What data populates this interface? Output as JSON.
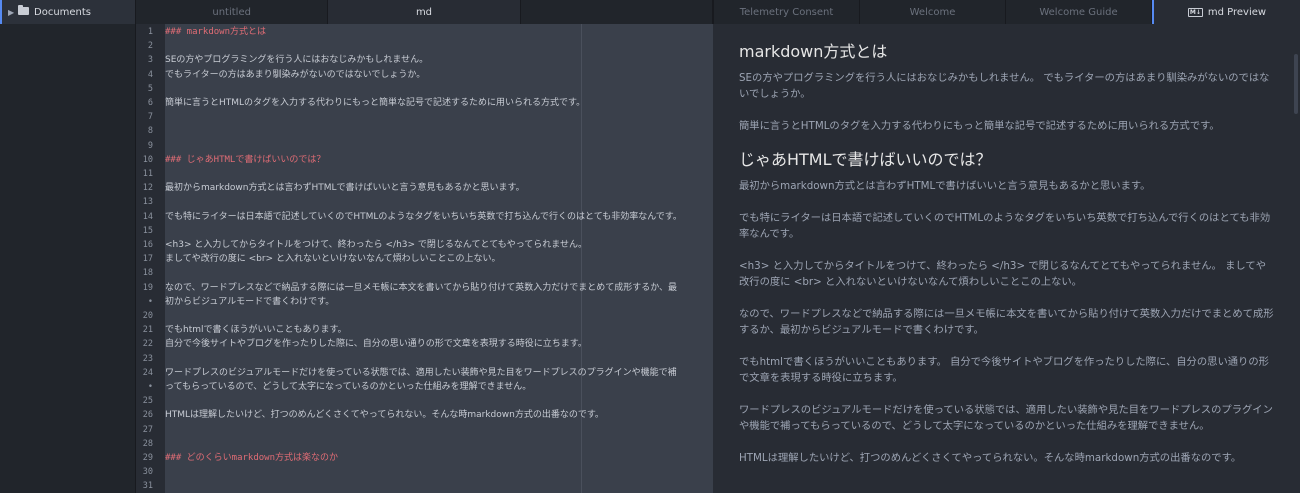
{
  "tree": {
    "root_label": "Documents"
  },
  "left_tabs": [
    {
      "label": "untitled",
      "active": false
    },
    {
      "label": "md",
      "active": true
    },
    {
      "label": "",
      "active": false
    }
  ],
  "right_tabs": [
    {
      "label": "Telemetry Consent"
    },
    {
      "label": "Welcome"
    },
    {
      "label": "Welcome Guide"
    },
    {
      "label": "md Preview"
    }
  ],
  "editor": {
    "lines": [
      {
        "n": "1",
        "text": "### markdown方式とは",
        "kind": "heading"
      },
      {
        "n": "2",
        "text": "",
        "kind": "text"
      },
      {
        "n": "3",
        "text": "SEの方やプログラミングを行う人にはおなじみかもしれません。",
        "kind": "text"
      },
      {
        "n": "4",
        "text": "でもライターの方はあまり馴染みがないのではないでしょうか。",
        "kind": "text"
      },
      {
        "n": "5",
        "text": "",
        "kind": "text"
      },
      {
        "n": "6",
        "text": "簡単に言うとHTMLのタグを入力する代わりにもっと簡単な記号で記述するために用いられる方式です。",
        "kind": "text"
      },
      {
        "n": "7",
        "text": "",
        "kind": "text"
      },
      {
        "n": "8",
        "text": "",
        "kind": "text"
      },
      {
        "n": "9",
        "text": "",
        "kind": "text"
      },
      {
        "n": "10",
        "text": "### じゃあHTMLで書けばいいのでは？",
        "kind": "heading"
      },
      {
        "n": "11",
        "text": "",
        "kind": "text"
      },
      {
        "n": "12",
        "text": "最初からmarkdown方式とは言わずHTMLで書けばいいと言う意見もあるかと思います。",
        "kind": "text"
      },
      {
        "n": "13",
        "text": "",
        "kind": "text"
      },
      {
        "n": "14",
        "text": "でも特にライターは日本語で記述していくのでHTMLのようなタグをいちいち英数で打ち込んで行くのはとても非効率なんです。",
        "kind": "text"
      },
      {
        "n": "15",
        "text": "",
        "kind": "text"
      },
      {
        "n": "16",
        "text": "<h3> と入力してからタイトルをつけて、終わったら </h3> で閉じるなんてとてもやってられません。",
        "kind": "text"
      },
      {
        "n": "17",
        "text": "ましてや改行の度に <br> と入れないといけないなんて煩わしいことこの上ない。",
        "kind": "text"
      },
      {
        "n": "18",
        "text": "",
        "kind": "text"
      },
      {
        "n": "19",
        "text": "なので、ワードプレスなどで納品する際には一旦メモ帳に本文を書いてから貼り付けて英数入力だけでまとめて成形するか、最",
        "kind": "text"
      },
      {
        "n": "•",
        "text": "初からビジュアルモードで書くわけです。",
        "kind": "text"
      },
      {
        "n": "20",
        "text": "",
        "kind": "text"
      },
      {
        "n": "21",
        "text": "でもhtmlで書くほうがいいこともあります。",
        "kind": "text"
      },
      {
        "n": "22",
        "text": "自分で今後サイトやブログを作ったりした際に、自分の思い通りの形で文章を表現する時役に立ちます。",
        "kind": "text"
      },
      {
        "n": "23",
        "text": "",
        "kind": "text"
      },
      {
        "n": "24",
        "text": "ワードプレスのビジュアルモードだけを使っている状態では、適用したい装飾や見た目をワードプレスのプラグインや機能で補",
        "kind": "text"
      },
      {
        "n": "•",
        "text": "ってもらっているので、どうして太字になっているのかといった仕組みを理解できません。",
        "kind": "text"
      },
      {
        "n": "25",
        "text": "",
        "kind": "text"
      },
      {
        "n": "26",
        "text": "HTMLは理解したいけど、打つのめんどくさくてやってられない。そんな時markdown方式の出番なのです。",
        "kind": "text"
      },
      {
        "n": "27",
        "text": "",
        "kind": "text"
      },
      {
        "n": "28",
        "text": "",
        "kind": "text"
      },
      {
        "n": "29",
        "text": "### どのくらいmarkdown方式は楽なのか",
        "kind": "heading"
      },
      {
        "n": "30",
        "text": "",
        "kind": "text"
      },
      {
        "n": "31",
        "text": "",
        "kind": "text"
      }
    ]
  },
  "preview": {
    "h1": "markdown方式とは",
    "p1": "SEの方やプログラミングを行う人にはおなじみかもしれません。 でもライターの方はあまり馴染みがないのではないでしょうか。",
    "p2": "簡単に言うとHTMLのタグを入力する代わりにもっと簡単な記号で記述するために用いられる方式です。",
    "h2": "じゃあHTMLで書けばいいのでは？",
    "p3": "最初からmarkdown方式とは言わずHTMLで書けばいいと言う意見もあるかと思います。",
    "p4": "でも特にライターは日本語で記述していくのでHTMLのようなタグをいちいち英数で打ち込んで行くのはとても非効率なんです。",
    "p5": "<h3> と入力してからタイトルをつけて、終わったら </h3> で閉じるなんてとてもやってられません。 ましてや改行の度に <br> と入れないといけないなんて煩わしいことこの上ない。",
    "p6": "なので、ワードプレスなどで納品する際には一旦メモ帳に本文を書いてから貼り付けて英数入力だけでまとめて成形するか、最初からビジュアルモードで書くわけです。",
    "p7": "でもhtmlで書くほうがいいこともあります。 自分で今後サイトやブログを作ったりした際に、自分の思い通りの形で文章を表現する時役に立ちます。",
    "p8": "ワードプレスのビジュアルモードだけを使っている状態では、適用したい装飾や見た目をワードプレスのプラグインや機能で補ってもらっているので、どうして太字になっているのかといった仕組みを理解できません。",
    "p9": "HTMLは理解したいけど、打つのめんどくさくてやってられない。そんな時markdown方式の出番なのです。"
  },
  "colors": {
    "accent": "#568af2",
    "heading_markdown": "#e06c75",
    "editor_bg": "#3a404b",
    "panel_bg": "#282c34"
  },
  "icons": {
    "tree_chevron": "chevron-right-icon",
    "tree_folder": "folder-icon",
    "preview_tab": "markdown-icon"
  }
}
